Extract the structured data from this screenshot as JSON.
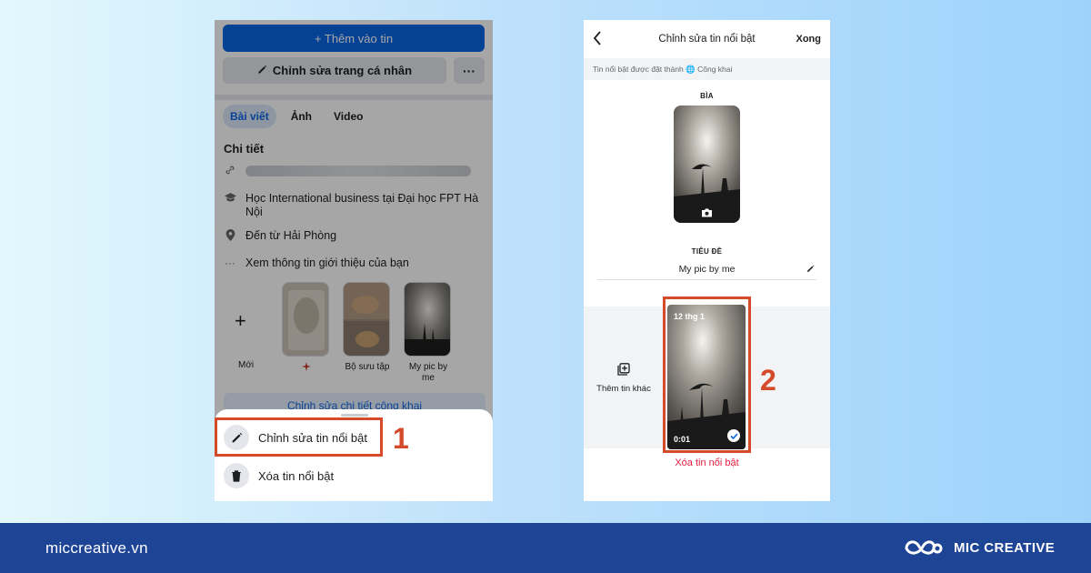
{
  "left_phone": {
    "add_story_button": "+ Thêm vào tin",
    "edit_profile_button": "Chỉnh sửa trang cá nhân",
    "more_button": "···",
    "tabs": [
      "Bài viết",
      "Ảnh",
      "Video"
    ],
    "details_title": "Chi tiết",
    "details": {
      "education": "Học International business tại Đại học FPT Hà Nội",
      "hometown": "Đến từ Hải Phòng",
      "about": "Xem thông tin giới thiệu của bạn"
    },
    "highlights": {
      "new_label": "Mới",
      "item2_label": "",
      "item3_label": "Bộ sưu tập",
      "item4_label": "My pic by me"
    },
    "edit_public_details": "Chỉnh sửa chi tiết công khai",
    "sheet": {
      "edit_highlight": "Chỉnh sửa tin nổi bật",
      "delete_highlight": "Xóa tin nổi bật"
    }
  },
  "right_phone": {
    "header_title": "Chỉnh sửa tin nổi bật",
    "done_label": "Xong",
    "privacy_note": "Tin nổi bật được đặt thành 🌐 Công khai",
    "cover_label": "BÌA",
    "title_label": "TIÊU ĐỀ",
    "title_value": "My pic by me",
    "add_story_label": "Thêm tin khác",
    "story_date": "12 thg 1",
    "story_duration": "0:01",
    "delete_highlight": "Xóa tin nổi bật"
  },
  "annotations": {
    "step1": "1",
    "step2": "2",
    "color": "#d54a2b"
  },
  "footer": {
    "url": "miccreative.vn",
    "brand": "MIC CREATIVE",
    "background": "#1e4496"
  },
  "colors": {
    "facebook_blue": "#0a66e4",
    "delete_red": "#e41e3f"
  }
}
